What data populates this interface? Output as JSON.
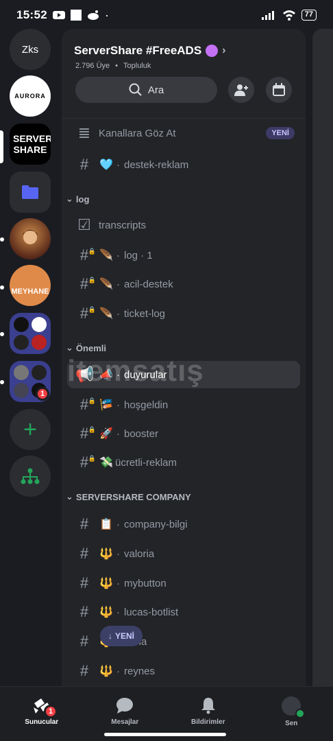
{
  "status": {
    "time": "15:52",
    "battery": "77"
  },
  "rail": {
    "home_label": "Zks",
    "servers": [
      "AURORA",
      "SERVER SHARE",
      "folder",
      "anime",
      "MEYHANE",
      "folder-group",
      "folder-group-2"
    ],
    "folder_badge": "1"
  },
  "server": {
    "name": "ServerShare #FreeADS",
    "members": "2.796 Üye",
    "community": "Topluluk",
    "search_label": "Ara"
  },
  "channels": {
    "browse": {
      "label": "Kanallara Göz At",
      "badge": "YENİ"
    },
    "destek": {
      "emoji": "🩵",
      "name": "destek-reklam"
    },
    "cat_log": "log",
    "log_items": [
      {
        "name": "transcripts"
      },
      {
        "emoji": "🪶",
        "name": "log · 1"
      },
      {
        "emoji": "🪶",
        "name": "acil-destek"
      },
      {
        "emoji": "🪶",
        "name": "ticket-log"
      }
    ],
    "cat_onemli": "Önemli",
    "onemli_items": [
      {
        "emoji": "📣",
        "name": "duyurular"
      },
      {
        "emoji": "🎏",
        "name": "hoşgeldin"
      },
      {
        "emoji": "🚀",
        "name": "booster"
      },
      {
        "emoji": "💸",
        "name": "ücretli-reklam"
      }
    ],
    "cat_company": "SERVERSHARE COMPANY",
    "company_items": [
      {
        "emoji": "📋",
        "name": "company-bilgi"
      },
      {
        "emoji": "🔱",
        "name": "valoria"
      },
      {
        "emoji": "🔱",
        "name": "mybutton"
      },
      {
        "emoji": "🔱",
        "name": "lucas-botlist"
      },
      {
        "emoji": "🔱",
        "name": "riana"
      },
      {
        "emoji": "🔱",
        "name": "reynes"
      }
    ],
    "new_float": "YENİ"
  },
  "watermark": "itemsatış",
  "nav": {
    "servers": "Sunucular",
    "servers_badge": "1",
    "messages": "Mesajlar",
    "notifications": "Bildirimler",
    "you": "Sen"
  },
  "colors": {
    "accent_green": "#23a55a",
    "badge_red": "#f23f43",
    "active_row": "#35373c"
  }
}
